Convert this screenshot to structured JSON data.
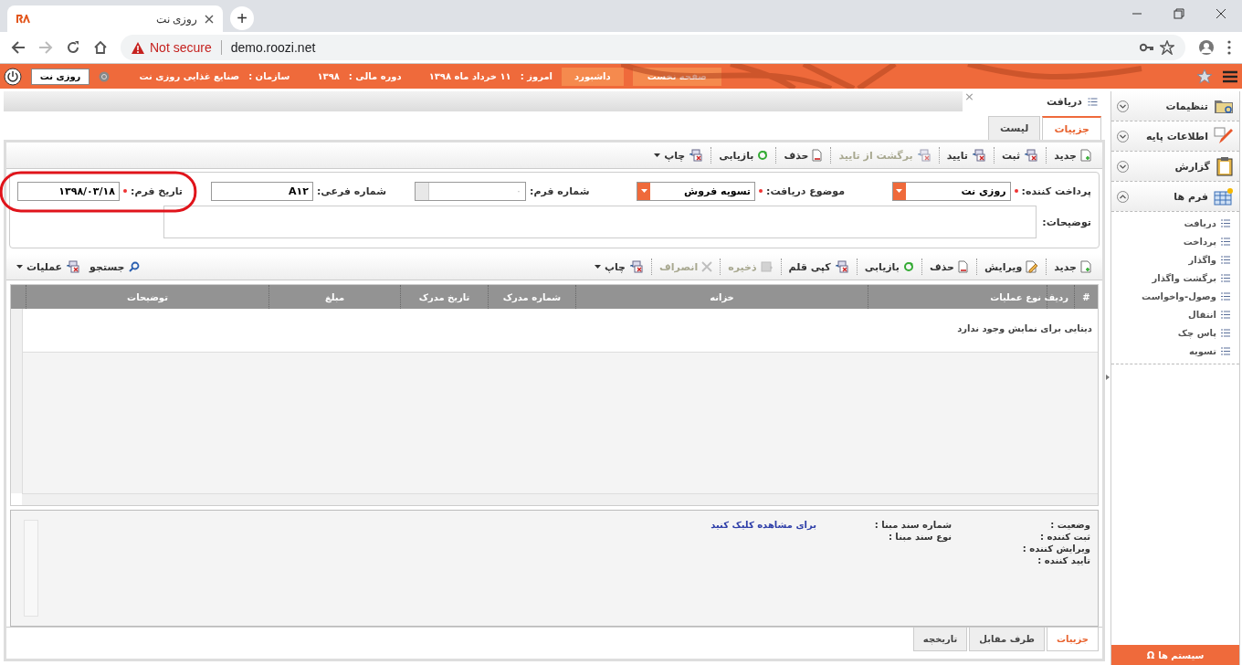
{
  "browser": {
    "tab_title": "روزی نت",
    "new_tab": "+",
    "security": "Not secure",
    "url": "demo.roozi.net"
  },
  "header": {
    "buttons": [
      {
        "label": "صفحه نخست"
      },
      {
        "label": "داشبورد"
      }
    ],
    "today_label": "امروز :",
    "today": "۱۱ خرداد ماه ۱۳۹۸",
    "fiscal_label": "دوره مالی :",
    "fiscal": "۱۳۹۸",
    "org_label": "سازمان :",
    "org": "صنایع غذایی روزی نت",
    "user": "روزی نت"
  },
  "document_tab": {
    "title": "دریافت",
    "close": "×"
  },
  "tabs": [
    {
      "label": "جزییات",
      "selected": true
    },
    {
      "label": "لیست",
      "selected": false
    }
  ],
  "toolbar": [
    {
      "label": "جدید",
      "disabled": false,
      "menu": false
    },
    {
      "label": "ثبت",
      "disabled": false,
      "menu": false
    },
    {
      "label": "تایید",
      "disabled": false,
      "menu": false
    },
    {
      "label": "برگشت از تایید",
      "disabled": true,
      "menu": false
    },
    {
      "label": "حذف",
      "disabled": false,
      "menu": false
    },
    {
      "label": "بازیابی",
      "disabled": false,
      "menu": false
    },
    {
      "label": "چاپ",
      "disabled": false,
      "menu": true
    }
  ],
  "form": {
    "fields": [
      {
        "kind": "combo",
        "label": "پرداخت کننده:",
        "required": true,
        "value": "روزی نت"
      },
      {
        "kind": "combo",
        "label": "موضوع دریافت:",
        "required": true,
        "value": "تسویه فروش"
      },
      {
        "kind": "spinner",
        "label": "شماره فرم:",
        "required": false,
        "placeholder": "۰"
      },
      {
        "kind": "text",
        "label": "شماره فرعی:",
        "required": false,
        "value": "A۱۲"
      },
      {
        "kind": "text",
        "label": "تاریخ فرم:",
        "required": true,
        "value": "۱۳۹۸/۰۳/۱۸",
        "highlighted": true
      }
    ],
    "notes_label": "توضیحات:"
  },
  "grid_toolbar": [
    {
      "label": "جدید",
      "disabled": false,
      "menu": false
    },
    {
      "label": "ویرایش",
      "disabled": false,
      "menu": false
    },
    {
      "label": "حذف",
      "disabled": false,
      "menu": false
    },
    {
      "label": "بازیابی",
      "disabled": false,
      "menu": false
    },
    {
      "label": "کپی قلم",
      "disabled": false,
      "menu": false
    },
    {
      "label": "ذخیره",
      "disabled": true,
      "menu": false
    },
    {
      "label": "انصراف",
      "disabled": true,
      "menu": false
    },
    {
      "label": "چاپ",
      "disabled": false,
      "menu": true
    }
  ],
  "grid_tools": [
    {
      "label": "جستجو",
      "menu": false
    },
    {
      "label": "عملیات",
      "menu": true
    }
  ],
  "table": {
    "columns": [
      "#",
      "ردیف",
      "نوع عملیات",
      "خزانه",
      "شماره مدرک",
      "تاریخ مدرک",
      "مبلغ",
      "توضیحات"
    ],
    "empty_message": "دیتایی برای نمایش وجود ندارد"
  },
  "details": {
    "labels": [
      "وضعیت :",
      "ثبت کننده :",
      "ویرایش کننده :",
      "تایید کننده :"
    ],
    "source_labels": [
      "شماره سند مبنا :",
      "نوع سند مبنا :"
    ],
    "link": "برای مشاهده کلیک کنید"
  },
  "bottom_tabs": [
    {
      "label": "جزییات",
      "selected": true
    },
    {
      "label": "طرف مقابل",
      "selected": false
    },
    {
      "label": "تاریخچه",
      "selected": false
    }
  ],
  "sidebar": {
    "groups": [
      {
        "label": "تنظیمات",
        "expanded": false
      },
      {
        "label": "اطلاعات پایه",
        "expanded": false
      },
      {
        "label": "گزارش",
        "expanded": false
      },
      {
        "label": "فرم ها",
        "expanded": true,
        "children": [
          {
            "label": "دریافت"
          },
          {
            "label": "پرداخت"
          },
          {
            "label": "واگذار"
          },
          {
            "label": "برگشت واگذار"
          },
          {
            "label": "وصول-واخواست"
          },
          {
            "label": "انتقال"
          },
          {
            "label": "پاس چک"
          },
          {
            "label": "تسویه"
          }
        ]
      }
    ],
    "systems": {
      "icon": "Ω",
      "label": "سیستم ها"
    }
  }
}
